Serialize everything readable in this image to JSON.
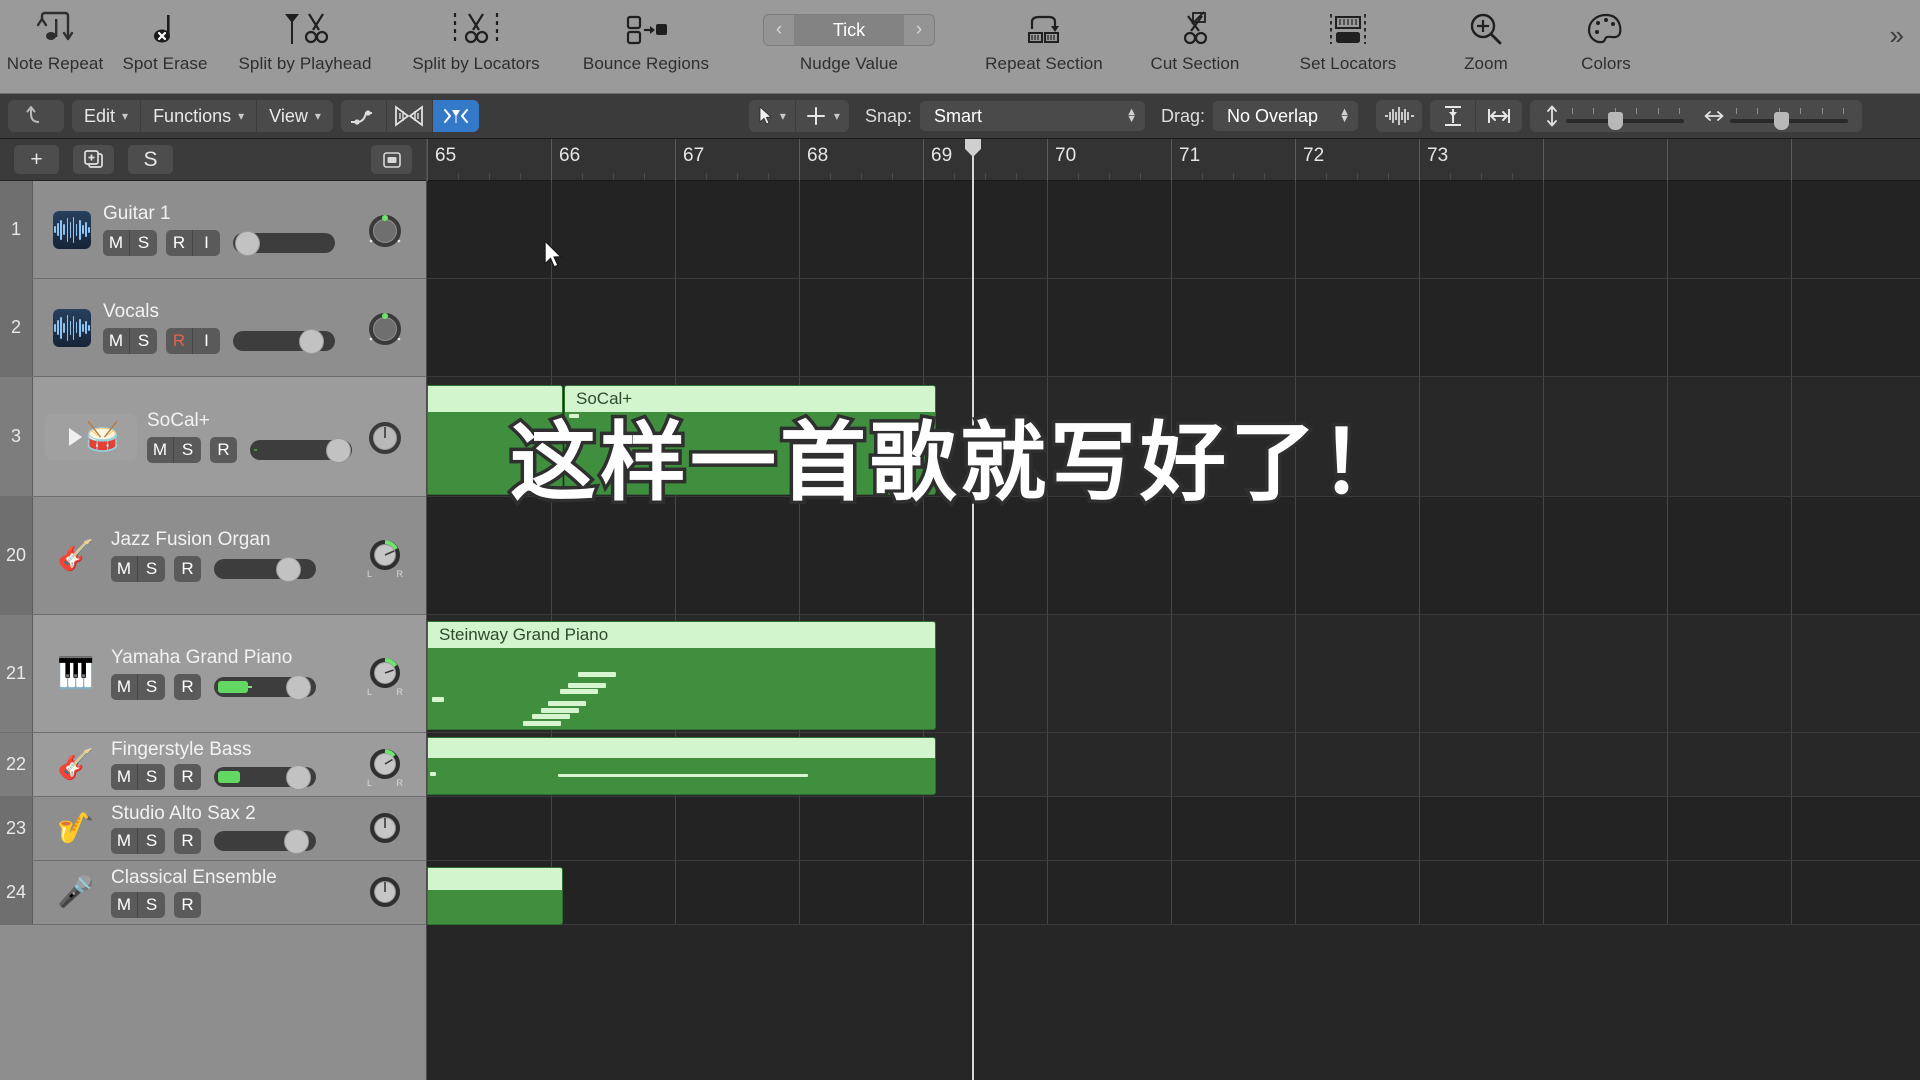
{
  "toolbar": {
    "items": [
      {
        "label": "Note Repeat",
        "icon": "note-repeat-icon"
      },
      {
        "label": "Spot Erase",
        "icon": "spot-erase-icon"
      },
      {
        "label": "Split by Playhead",
        "icon": "split-by-playhead-icon"
      },
      {
        "label": "Split by Locators",
        "icon": "split-by-locators-icon"
      },
      {
        "label": "Bounce Regions",
        "icon": "bounce-regions-icon"
      }
    ],
    "nudge": {
      "label": "Nudge Value",
      "value": "Tick",
      "prev": "‹",
      "next": "›"
    },
    "items_right": [
      {
        "label": "Repeat Section",
        "icon": "repeat-section-icon"
      },
      {
        "label": "Cut Section",
        "icon": "cut-section-icon"
      },
      {
        "label": "Set Locators",
        "icon": "set-locators-icon"
      },
      {
        "label": "Zoom",
        "icon": "zoom-icon"
      },
      {
        "label": "Colors",
        "icon": "colors-icon"
      }
    ],
    "overflow": "»"
  },
  "menubar": {
    "undo_icon": "undo-arrow-icon",
    "menus": [
      {
        "label": "Edit"
      },
      {
        "label": "Functions"
      },
      {
        "label": "View"
      }
    ],
    "tool_icons": [
      {
        "name": "automation-curve-icon"
      },
      {
        "name": "flex-time-icon"
      },
      {
        "name": "fade-tool-icon",
        "active": true
      }
    ],
    "pointer_tools": [
      {
        "name": "pointer-tool-icon"
      },
      {
        "name": "marquee-tool-icon"
      }
    ],
    "snap": {
      "label": "Snap:",
      "value": "Smart"
    },
    "drag": {
      "label": "Drag:",
      "value": "No Overlap"
    },
    "right_icons": [
      {
        "name": "waveform-zoom-icon"
      },
      {
        "name": "vertical-auto-zoom-icon"
      },
      {
        "name": "horizontal-fit-icon"
      }
    ],
    "vertical_zoom": {
      "name": "vertical-zoom-slider"
    },
    "horizontal_zoom": {
      "name": "horizontal-zoom-slider"
    }
  },
  "track_header_toolbar": {
    "add_track": "+",
    "duplicate_track": "duplicate-track-icon",
    "solo_all": "S",
    "config_button": "track-config-icon"
  },
  "tracks": [
    {
      "number": "1",
      "name": "Guitar 1",
      "icon": "audio-waveform-icon",
      "type": "audio",
      "buttons": [
        "M",
        "S",
        "R",
        "I"
      ],
      "record_armed": false,
      "volume_pct": 6,
      "meter_pct": 0,
      "pan": 0,
      "selected": false
    },
    {
      "number": "2",
      "name": "Vocals",
      "icon": "audio-waveform-icon",
      "type": "audio",
      "buttons": [
        "M",
        "S",
        "R",
        "I"
      ],
      "record_armed": true,
      "volume_pct": 70,
      "meter_pct": 0,
      "pan": 0,
      "selected": false
    },
    {
      "number": "3",
      "name": "SoCal+",
      "icon": "drum-kit-icon",
      "type": "drummer",
      "buttons": [
        "M",
        "S",
        "R"
      ],
      "record_armed": false,
      "volume_pct": 96,
      "meter_pct": 3,
      "pan": 0,
      "selected": true
    },
    {
      "number": "20",
      "name": "Jazz Fusion Organ",
      "icon": "organ-icon",
      "type": "instrument",
      "buttons": [
        "M",
        "S",
        "R"
      ],
      "record_armed": false,
      "volume_pct": 82,
      "meter_pct": 0,
      "pan": 28,
      "selected": false
    },
    {
      "number": "21",
      "name": "Yamaha Grand Piano",
      "icon": "grand-piano-icon",
      "type": "instrument",
      "buttons": [
        "M",
        "S",
        "R"
      ],
      "record_armed": false,
      "volume_pct": 90,
      "meter_pct": 30,
      "pan": 22,
      "selected": true
    },
    {
      "number": "22",
      "name": "Fingerstyle Bass",
      "icon": "bass-guitar-icon",
      "type": "instrument",
      "buttons": [
        "M",
        "S",
        "R"
      ],
      "record_armed": false,
      "volume_pct": 90,
      "meter_pct": 26,
      "pan": 18,
      "selected": true
    },
    {
      "number": "23",
      "name": "Studio Alto Sax 2",
      "icon": "saxophone-icon",
      "type": "instrument",
      "buttons": [
        "M",
        "S",
        "R"
      ],
      "record_armed": false,
      "volume_pct": 88,
      "meter_pct": 0,
      "pan": 0,
      "selected": false
    },
    {
      "number": "24",
      "name": "Classical Ensemble",
      "icon": "ensemble-icon",
      "type": "instrument",
      "buttons": [
        "M",
        "S",
        "R"
      ],
      "record_armed": false,
      "volume_pct": 85,
      "meter_pct": 0,
      "pan": 0,
      "selected": false
    }
  ],
  "ruler": {
    "bars": [
      "65",
      "66",
      "67",
      "68",
      "69",
      "70",
      "71",
      "72",
      "73"
    ],
    "playhead_bar": "69"
  },
  "regions": [
    {
      "name": "",
      "track": "3",
      "label_visible": false
    },
    {
      "name": "SoCal+",
      "track": "3",
      "label_visible": true
    },
    {
      "name": "Steinway Grand Piano",
      "track": "21",
      "label_visible": true
    },
    {
      "name": "",
      "track": "22",
      "label_visible": false
    },
    {
      "name": "",
      "track": "24",
      "label_visible": false
    }
  ],
  "subtitle": {
    "text": "这样一首歌就写好了！"
  },
  "colors": {
    "toolbar_bg": "#9a9a9a",
    "menubar_bg": "#3b3b3b",
    "header_bg": "#8e8e8e",
    "arrange_bg": "#262626",
    "region_green": "#3f8f3f",
    "region_header": "#d2f5cd",
    "accent_blue": "#3478c8",
    "record_red": "#e8604c"
  }
}
